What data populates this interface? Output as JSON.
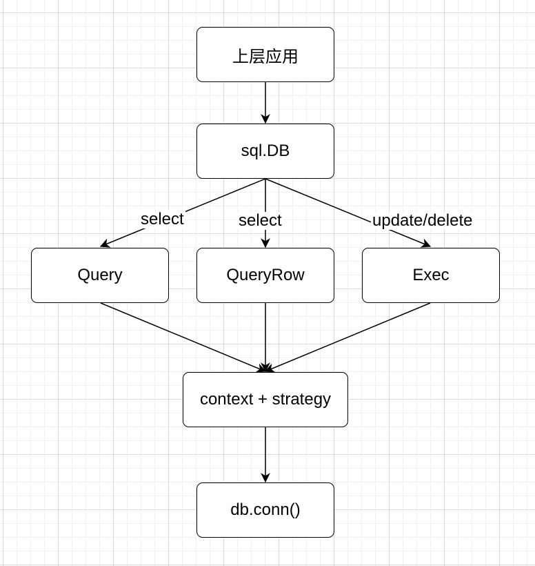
{
  "nodes": {
    "app": "上层应用",
    "sqldb": "sql.DB",
    "query": "Query",
    "queryrow": "QueryRow",
    "exec": "Exec",
    "context": "context + strategy",
    "conn": "db.conn()"
  },
  "edge_labels": {
    "to_query": "select",
    "to_queryrow": "select",
    "to_exec": "update/delete"
  }
}
